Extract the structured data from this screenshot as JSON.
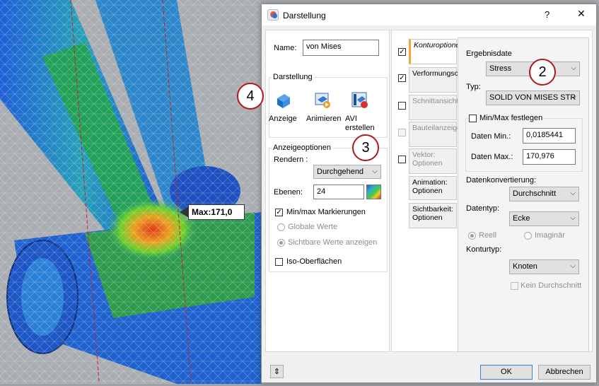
{
  "viewport": {
    "max_label": "Max:171,0"
  },
  "dialog": {
    "title": "Darstellung",
    "help_label": "?",
    "close_label": "✕",
    "name_label": "Name:",
    "name_value": "von Mises",
    "darstellung_group": "Darstellung",
    "buttons": [
      {
        "label": "Anzeige"
      },
      {
        "label": "Animieren"
      },
      {
        "label": "AVI erstellen"
      }
    ],
    "anzeige_group": "Anzeigeoptionen",
    "rendern_label": "Rendern :",
    "rendern_value": "Durchgehend",
    "ebenen_label": "Ebenen:",
    "ebenen_value": "24",
    "minmax_label": "Min/max Markierungen",
    "globale_label": "Globale Werte",
    "sichtbare_label": "Sichtbare Werte anzeigen",
    "iso_label": "Iso-Oberflächen",
    "tabs": [
      {
        "label": "Konturoptionen",
        "checked": "☑"
      },
      {
        "label": "Verformungsoptionen",
        "checked": "☑"
      },
      {
        "label": "Schnittansicht",
        "checked": ""
      },
      {
        "label": "Bauteilanzeige",
        "checked": ""
      },
      {
        "label": "Vektor: Optionen",
        "checked": ""
      },
      {
        "label": "Animation: Optionen"
      },
      {
        "label": "Sichtbarkeit: Optionen"
      }
    ],
    "ergebnis_label": "Ergebnisdate",
    "ergebnis_value": "Stress",
    "typ_label": "Typ:",
    "typ_value": "SOLID VON MISES STR",
    "minmax_fest_label": "Min/Max festlegen",
    "daten_min_label": "Daten Min.:",
    "daten_min_value": "0,0185441",
    "daten_max_label": "Daten Max.:",
    "daten_max_value": "170,976",
    "datenkonv_label": "Datenkonvertierung:",
    "datenkonv_value": "Durchschnitt",
    "datentyp_label": "Datentyp:",
    "datentyp_value": "Ecke",
    "reell_label": "Reell",
    "imaginar_label": "Imaginär",
    "konturtyp_label": "Konturtyp:",
    "konturtyp_value": "Knoten",
    "kein_label": "Kein Durchschnitt",
    "expand_label": "⇕",
    "ok_label": "OK",
    "abbrechen_label": "Abbrechen"
  },
  "callouts": {
    "c2": "2",
    "c3": "3",
    "c4": "4"
  }
}
